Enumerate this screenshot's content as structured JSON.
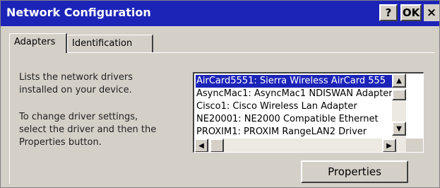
{
  "window": {
    "title": "Network Configuration",
    "help_label": "?",
    "ok_label": "OK",
    "close_label": "×"
  },
  "tabs": [
    {
      "label": "Adapters",
      "selected": true
    },
    {
      "label": "Identification",
      "selected": false
    }
  ],
  "description": {
    "lines1": [
      "Lists the network drivers",
      "installed on your device."
    ],
    "lines2": [
      "To change driver settings,",
      "select the driver and then the",
      "Properties button."
    ]
  },
  "adapters_list": {
    "items": [
      "AirCard5551: Sierra Wireless AirCard 555",
      "AsyncMac1: AsyncMac1 NDISWAN Adapter",
      "Cisco1: Cisco Wireless Lan Adapter",
      "NE20001: NE2000 Compatible Ethernet",
      "PROXIM1: PROXIM RangeLAN2 Driver"
    ],
    "selected_index": 0
  },
  "scroll_icons": {
    "up": "▲",
    "down": "▼",
    "left": "◀",
    "right": "▶"
  },
  "properties_button": {
    "label": "Properties"
  },
  "colors": {
    "titlebar": "#1c24b8",
    "selection": "#1c24b8",
    "face": "#d4d0c8"
  }
}
